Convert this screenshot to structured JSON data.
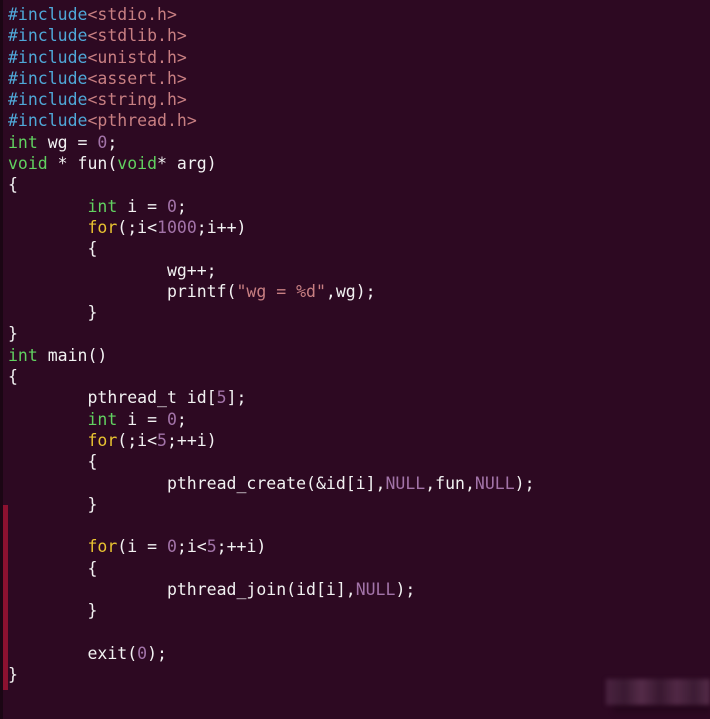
{
  "editor": {
    "background_color": "#2d0922",
    "default_text_color": "#ffffff",
    "font": "monospace",
    "marker_strip_color": "#8c1130"
  },
  "palette": {
    "preprocessor": "#4fa8d8",
    "header_name": "#c87f82",
    "keyword": "#61d160",
    "control": "#e8c331",
    "number": "#a273a8",
    "string": "#c87f82",
    "plain": "#f2f2f2"
  },
  "code": {
    "language": "c",
    "lines": [
      {
        "n": 1,
        "tokens": [
          {
            "t": "#include",
            "c": "pre"
          },
          {
            "t": "<stdio.h>",
            "c": "hdr"
          }
        ]
      },
      {
        "n": 2,
        "tokens": [
          {
            "t": "#include",
            "c": "pre"
          },
          {
            "t": "<stdlib.h>",
            "c": "hdr"
          }
        ]
      },
      {
        "n": 3,
        "tokens": [
          {
            "t": "#include",
            "c": "pre"
          },
          {
            "t": "<unistd.h>",
            "c": "hdr"
          }
        ]
      },
      {
        "n": 4,
        "tokens": [
          {
            "t": "#include",
            "c": "pre"
          },
          {
            "t": "<assert.h>",
            "c": "hdr"
          }
        ]
      },
      {
        "n": 5,
        "tokens": [
          {
            "t": "#include",
            "c": "pre"
          },
          {
            "t": "<string.h>",
            "c": "hdr"
          }
        ]
      },
      {
        "n": 6,
        "tokens": [
          {
            "t": "#include",
            "c": "pre"
          },
          {
            "t": "<pthread.h>",
            "c": "hdr"
          }
        ]
      },
      {
        "n": 7,
        "tokens": [
          {
            "t": "int",
            "c": "kw"
          },
          {
            "t": " wg = ",
            "c": "plain"
          },
          {
            "t": "0",
            "c": "num"
          },
          {
            "t": ";",
            "c": "plain"
          }
        ]
      },
      {
        "n": 8,
        "tokens": [
          {
            "t": "void",
            "c": "kw"
          },
          {
            "t": " * fun(",
            "c": "plain"
          },
          {
            "t": "void",
            "c": "kw"
          },
          {
            "t": "* arg)",
            "c": "plain"
          }
        ]
      },
      {
        "n": 9,
        "tokens": [
          {
            "t": "{",
            "c": "plain"
          }
        ]
      },
      {
        "n": 10,
        "tokens": [
          {
            "t": "        ",
            "c": "plain"
          },
          {
            "t": "int",
            "c": "kw"
          },
          {
            "t": " i = ",
            "c": "plain"
          },
          {
            "t": "0",
            "c": "num"
          },
          {
            "t": ";",
            "c": "plain"
          }
        ]
      },
      {
        "n": 11,
        "tokens": [
          {
            "t": "        ",
            "c": "plain"
          },
          {
            "t": "for",
            "c": "ctl"
          },
          {
            "t": "(;i<",
            "c": "plain"
          },
          {
            "t": "1000",
            "c": "num"
          },
          {
            "t": ";i++)",
            "c": "plain"
          }
        ]
      },
      {
        "n": 12,
        "tokens": [
          {
            "t": "        {",
            "c": "plain"
          }
        ]
      },
      {
        "n": 13,
        "tokens": [
          {
            "t": "                wg++;",
            "c": "plain"
          }
        ]
      },
      {
        "n": 14,
        "tokens": [
          {
            "t": "                printf(",
            "c": "plain"
          },
          {
            "t": "\"wg = %d\"",
            "c": "str"
          },
          {
            "t": ",wg);",
            "c": "plain"
          }
        ]
      },
      {
        "n": 15,
        "tokens": [
          {
            "t": "        }",
            "c": "plain"
          }
        ]
      },
      {
        "n": 16,
        "tokens": [
          {
            "t": "}",
            "c": "plain"
          }
        ]
      },
      {
        "n": 17,
        "tokens": [
          {
            "t": "int",
            "c": "kw"
          },
          {
            "t": " main()",
            "c": "plain"
          }
        ]
      },
      {
        "n": 18,
        "tokens": [
          {
            "t": "{",
            "c": "plain"
          }
        ]
      },
      {
        "n": 19,
        "tokens": [
          {
            "t": "        pthread_t id[",
            "c": "plain"
          },
          {
            "t": "5",
            "c": "num"
          },
          {
            "t": "];",
            "c": "plain"
          }
        ]
      },
      {
        "n": 20,
        "tokens": [
          {
            "t": "        ",
            "c": "plain"
          },
          {
            "t": "int",
            "c": "kw"
          },
          {
            "t": " i = ",
            "c": "plain"
          },
          {
            "t": "0",
            "c": "num"
          },
          {
            "t": ";",
            "c": "plain"
          }
        ]
      },
      {
        "n": 21,
        "tokens": [
          {
            "t": "        ",
            "c": "plain"
          },
          {
            "t": "for",
            "c": "ctl"
          },
          {
            "t": "(;i<",
            "c": "plain"
          },
          {
            "t": "5",
            "c": "num"
          },
          {
            "t": ";++i)",
            "c": "plain"
          }
        ]
      },
      {
        "n": 22,
        "tokens": [
          {
            "t": "        {",
            "c": "plain"
          }
        ]
      },
      {
        "n": 23,
        "tokens": [
          {
            "t": "                pthread_create(&id[i],",
            "c": "plain"
          },
          {
            "t": "NULL",
            "c": "num"
          },
          {
            "t": ",fun,",
            "c": "plain"
          },
          {
            "t": "NULL",
            "c": "num"
          },
          {
            "t": ");",
            "c": "plain"
          }
        ]
      },
      {
        "n": 24,
        "tokens": [
          {
            "t": "        }",
            "c": "plain"
          }
        ]
      },
      {
        "n": 25,
        "tokens": [
          {
            "t": "",
            "c": "plain"
          }
        ]
      },
      {
        "n": 26,
        "tokens": [
          {
            "t": "        ",
            "c": "plain"
          },
          {
            "t": "for",
            "c": "ctl"
          },
          {
            "t": "(i = ",
            "c": "plain"
          },
          {
            "t": "0",
            "c": "num"
          },
          {
            "t": ";i<",
            "c": "plain"
          },
          {
            "t": "5",
            "c": "num"
          },
          {
            "t": ";++i)",
            "c": "plain"
          }
        ]
      },
      {
        "n": 27,
        "tokens": [
          {
            "t": "        {",
            "c": "plain"
          }
        ]
      },
      {
        "n": 28,
        "tokens": [
          {
            "t": "                pthread_join(id[i],",
            "c": "plain"
          },
          {
            "t": "NULL",
            "c": "num"
          },
          {
            "t": ");",
            "c": "plain"
          }
        ]
      },
      {
        "n": 29,
        "tokens": [
          {
            "t": "        }",
            "c": "plain"
          }
        ]
      },
      {
        "n": 30,
        "tokens": [
          {
            "t": "",
            "c": "plain"
          }
        ]
      },
      {
        "n": 31,
        "tokens": [
          {
            "t": "        exit(",
            "c": "plain"
          },
          {
            "t": "0",
            "c": "num"
          },
          {
            "t": ");",
            "c": "plain"
          }
        ]
      },
      {
        "n": 32,
        "tokens": [
          {
            "t": "}",
            "c": "plain"
          }
        ]
      }
    ]
  }
}
